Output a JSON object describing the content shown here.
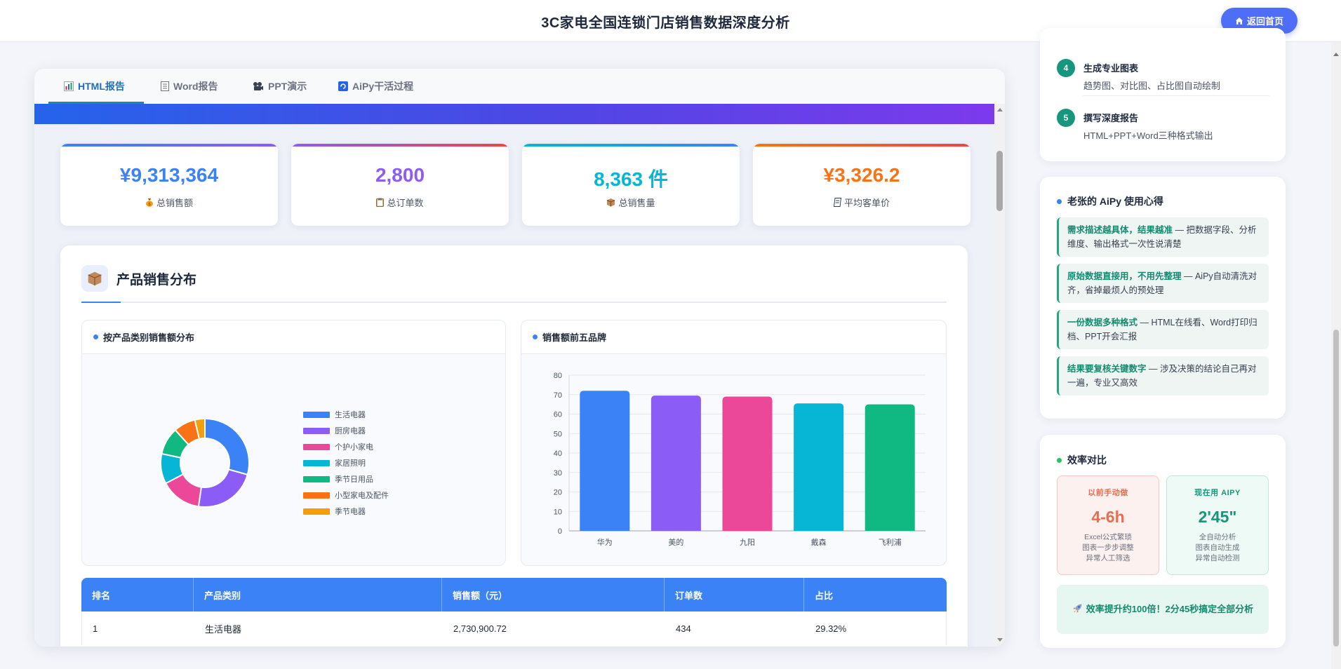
{
  "header": {
    "title": "3C家电全国连锁门店销售数据深度分析",
    "home_label": "返回首页"
  },
  "tabs": [
    {
      "label": "HTML报告",
      "icon": "bar-chart-icon"
    },
    {
      "label": "Word报告",
      "icon": "document-icon"
    },
    {
      "label": "PPT演示",
      "icon": "projector-icon"
    },
    {
      "label": "AiPy干活过程",
      "icon": "refresh-icon"
    }
  ],
  "stats": [
    {
      "value": "¥9,313,364",
      "label": "总销售额",
      "icon": "money-bag-icon",
      "color": "#3b82f6"
    },
    {
      "value": "2,800",
      "label": "总订单数",
      "icon": "clipboard-icon",
      "color": "#8b5cf6"
    },
    {
      "value": "8,363 件",
      "label": "总销售量",
      "icon": "box-icon",
      "color": "#06b6d4"
    },
    {
      "value": "¥3,326.2",
      "label": "平均客单价",
      "icon": "receipt-icon",
      "color": "#f97316"
    }
  ],
  "section": {
    "title": "产品销售分布",
    "icon": "box-icon"
  },
  "donut": {
    "title": "按产品类别销售额分布",
    "legend": [
      "生活电器",
      "厨房电器",
      "个护小家电",
      "家居照明",
      "季节日用品",
      "小型家电及配件",
      "季节电器"
    ],
    "colors": [
      "#3b82f6",
      "#8b5cf6",
      "#ec4899",
      "#06b6d4",
      "#10b981",
      "#f97316",
      "#f59e0b"
    ]
  },
  "chart_data": {
    "type": "bar",
    "title": "销售额前五品牌",
    "categories": [
      "华为",
      "美的",
      "九阳",
      "戴森",
      "飞利浦"
    ],
    "values": [
      72,
      69.5,
      69,
      65.5,
      65
    ],
    "ylim": [
      0,
      80
    ],
    "yticks": [
      0,
      10,
      20,
      30,
      40,
      50,
      60,
      70,
      80
    ],
    "colors": [
      "#3b82f6",
      "#8b5cf6",
      "#ec4899",
      "#06b6d4",
      "#10b981"
    ],
    "grid": true
  },
  "table": {
    "headers": [
      "排名",
      "产品类别",
      "销售额（元）",
      "订单数",
      "占比"
    ],
    "rows": [
      [
        "1",
        "生活电器",
        "2,730,900.72",
        "434",
        "29.32%"
      ]
    ]
  },
  "workflow": [
    {
      "num": "4",
      "title": "生成专业图表",
      "desc": "趋势图、对比图、占比图自动绘制"
    },
    {
      "num": "5",
      "title": "撰写深度报告",
      "desc": "HTML+PPT+Word三种格式输出"
    }
  ],
  "tips": {
    "title": "老张的 AiPy 使用心得",
    "items": [
      {
        "bold": "需求描述越具体，结果越准",
        "text": " — 把数据字段、分析维度、输出格式一次性说清楚"
      },
      {
        "bold": "原始数据直接用，不用先整理",
        "text": " — AiPy自动清洗对齐，省掉最烦人的预处理"
      },
      {
        "bold": "一份数据多种格式",
        "text": " — HTML在线看、Word打印归档、PPT开会汇报"
      },
      {
        "bold": "结果要复核关键数字",
        "text": " — 涉及决策的结论自己再对一遍，专业又高效"
      }
    ]
  },
  "efficiency": {
    "title": "效率对比",
    "before": {
      "label": "以前手动做",
      "value": "4-6h",
      "l1": "Excel公式繁琐",
      "l2": "图表一步步调整",
      "l3": "异常人工筛选",
      "color": "#e76f51"
    },
    "after": {
      "label": "现在用 AIPY",
      "value": "2'45\"",
      "l1": "全自动分析",
      "l2": "图表自动生成",
      "l3": "异常自动检测",
      "color": "#16967c"
    },
    "note": "效率提升约100倍！2分45秒搞定全部分析"
  }
}
